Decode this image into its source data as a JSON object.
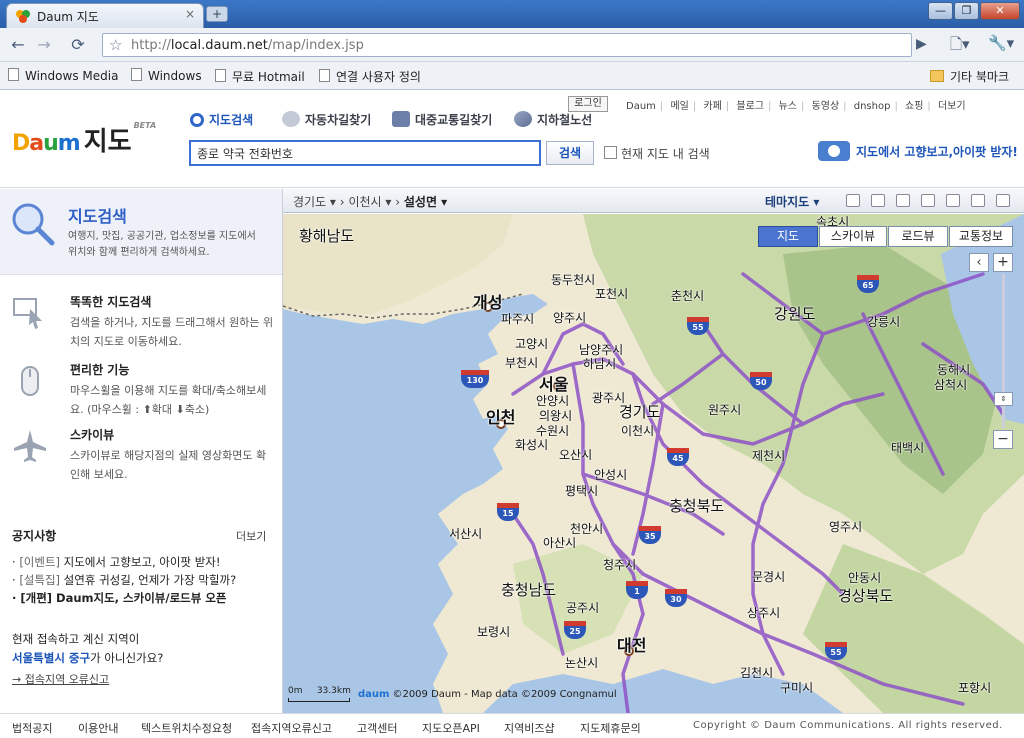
{
  "browser": {
    "tab_title": "Daum 지도",
    "tab_close": "×",
    "new_tab": "+",
    "window_controls": [
      "—",
      "❐",
      "✕"
    ],
    "url_prefix": "http://",
    "url_host": "local.daum.net",
    "url_path": "/map/index.jsp",
    "bookmarks": [
      "Windows Media",
      "Windows",
      "무료 Hotmail",
      "연결 사용자 정의"
    ],
    "other_bookmarks": "기타 북마크"
  },
  "header": {
    "logo_jido": "지도",
    "logo_beta": "BETA",
    "tabs": [
      "지도검색",
      "자동차길찾기",
      "대중교통길찾기",
      "지하철노선"
    ],
    "search_value": "종로 약국 전화번호",
    "search_button": "검색",
    "checkbox_label": "현재 지도 내 검색",
    "login": "로그인",
    "gnb": [
      "Daum",
      "메일",
      "카페",
      "블로그",
      "뉴스",
      "동영상",
      "dnshop",
      "쇼핑",
      "더보기"
    ],
    "promo": "지도에서 고향보고,아이팟 받자!"
  },
  "sidebar": {
    "hero_title": "지도검색",
    "hero_desc": "여행지, 맛집, 공공기관, 업소정보를 지도에서 위치와 함께 편리하게 검색하세요.",
    "features": [
      {
        "title": "똑똑한 지도검색",
        "desc": "검색을 하거나, 지도를 드래그해서 원하는 위치의 지도로 이동하세요."
      },
      {
        "title": "편리한 기능",
        "desc": "마우스휠을 이용해 지도를 확대/축소해보세요. (마우스휠 : ⬆확대 ⬇축소)"
      },
      {
        "title": "스카이뷰",
        "desc": "스카이뷰로 해당지점의 실제 영상화면도 확인해 보세요."
      }
    ],
    "notice_title": "공지사항",
    "notice_more": "더보기",
    "notices": [
      {
        "tag": "[이벤트]",
        "text": " 지도에서 고향보고, 아이팟 받자!"
      },
      {
        "tag": "[설특집]",
        "text": " 설연휴 귀성길, 언제가 가장 막힐까?"
      },
      {
        "tag": "[개편]",
        "text": " Daum지도, 스카이뷰/로드뷰 오픈"
      }
    ],
    "region_question": "현재 접속하고 계신 지역이",
    "region_name": "서울특별시 중구",
    "region_suffix": "가 아니신가요?",
    "region_link": "→ 접속지역 오류신고",
    "collapse": "◀"
  },
  "map": {
    "breadcrumb": [
      "경기도 ▾",
      "이천시 ▾",
      "설성면 ▾"
    ],
    "breadcrumb_sep": "›",
    "theme": "테마지도 ▾",
    "map_types": [
      "지도",
      "스카이뷰",
      "로드뷰",
      "교통정보"
    ],
    "zoom_in": "+",
    "zoom_out": "−",
    "pan_left": "‹",
    "scale_zero": "0m",
    "scale": "33.3km",
    "copyright_logo": "daum",
    "copyright": "©2009 Daum - Map data ©2009 Congnamul",
    "labels": {
      "hwanghae": "황해남도",
      "kaesong": "개성",
      "dongducheon": "동두천시",
      "pocheon": "포천시",
      "paju": "파주시",
      "yangju": "양주시",
      "chuncheon": "춘천시",
      "sokcho": "속초시",
      "goyang": "고양시",
      "namyangju": "남양주시",
      "hanam": "하남시",
      "bucheon": "부천시",
      "seoul": "서울",
      "anyang": "안양시",
      "gwangju": "광주시",
      "euiwang": "의왕시",
      "incheon": "인천",
      "gyeonggi": "경기도",
      "suwon": "수원시",
      "icheon": "이천시",
      "hwaseong": "화성시",
      "osan": "오산시",
      "anseong": "안성시",
      "pyeongtaek": "평택시",
      "gangwon": "강원도",
      "gangneung": "강릉시",
      "wonju": "원주시",
      "donghae": "동해시",
      "samcheok": "삼척시",
      "taebaek": "태백시",
      "jecheon": "제천시",
      "chungbuk": "충청북도",
      "seosan": "서산시",
      "cheonan": "천안시",
      "asan": "아산시",
      "cheongju": "청주시",
      "yeongju": "영주시",
      "chungnam": "충청남도",
      "mungyeong": "문경시",
      "andong": "안동시",
      "gyeongbuk": "경상북도",
      "gongju": "공주시",
      "sangju": "상주시",
      "boryeong": "보령시",
      "daejeon": "대전",
      "nonsan": "논산시",
      "gimcheon": "김천시",
      "gumi": "구미시",
      "pohang": "포항시"
    },
    "highways": [
      "65",
      "55",
      "50",
      "130",
      "45",
      "15",
      "35",
      "1",
      "30",
      "25",
      "55"
    ]
  },
  "footer": {
    "links": [
      "법적공지",
      "이용안내",
      "텍스트위치수정요청",
      "접속지역오류신고",
      "고객센터",
      "지도오픈API",
      "지역비즈샵",
      "지도제휴문의"
    ],
    "copyright": "Copyright © Daum Communications. All rights reserved."
  }
}
